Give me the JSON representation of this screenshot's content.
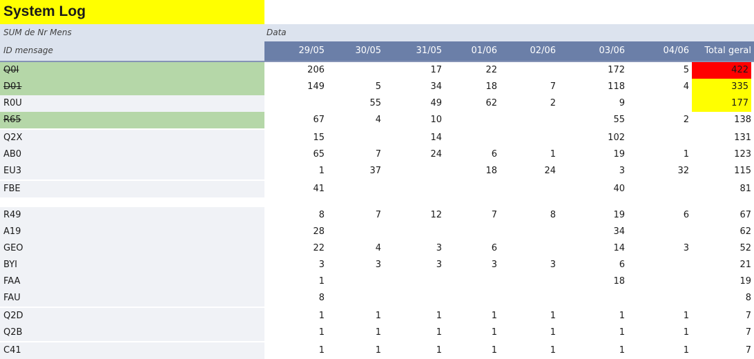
{
  "sheet": {
    "title": "System Log",
    "pivot_value_label": "SUM de Nr Mens",
    "column_field_label": "Data",
    "row_field_label": "ID mensage",
    "columns": [
      "29/05",
      "30/05",
      "31/05",
      "01/06",
      "02/06",
      "03/06",
      "04/06",
      "Total geral"
    ],
    "colors": {
      "title_fill": "#ffff00",
      "header_fill": "#6b7fa8",
      "header_light": "#dce3ee",
      "highlight_row": "#b5d7a8",
      "total_red": "#ff0000",
      "total_yellow": "#ffff00"
    },
    "rows": [
      {
        "id": "Q0I",
        "struck": true,
        "highlight": true,
        "values": [
          "206",
          "",
          "17",
          "22",
          "",
          "172",
          "5"
        ],
        "total": "422",
        "total_fill": "red"
      },
      {
        "id": "D01",
        "struck": true,
        "highlight": true,
        "values": [
          "149",
          "5",
          "34",
          "18",
          "7",
          "118",
          "4"
        ],
        "total": "335",
        "total_fill": "yellow"
      },
      {
        "id": "R0U",
        "struck": false,
        "highlight": false,
        "values": [
          "",
          "55",
          "49",
          "62",
          "2",
          "9",
          ""
        ],
        "total": "177",
        "total_fill": "yellow"
      },
      {
        "id": "R65",
        "struck": true,
        "highlight": true,
        "values": [
          "67",
          "4",
          "10",
          "",
          "",
          "55",
          "2"
        ],
        "total": "138",
        "total_fill": ""
      },
      {
        "id": "Q2X",
        "struck": false,
        "highlight": false,
        "values": [
          "15",
          "",
          "14",
          "",
          "",
          "102",
          ""
        ],
        "total": "131",
        "total_fill": ""
      },
      {
        "id": "AB0",
        "struck": false,
        "highlight": false,
        "values": [
          "65",
          "7",
          "24",
          "6",
          "1",
          "19",
          "1"
        ],
        "total": "123",
        "total_fill": ""
      },
      {
        "id": "EU3",
        "struck": false,
        "highlight": false,
        "values": [
          "1",
          "37",
          "",
          "18",
          "24",
          "3",
          "32"
        ],
        "total": "115",
        "total_fill": ""
      },
      {
        "id": "FBE",
        "struck": false,
        "highlight": false,
        "values": [
          "41",
          "",
          "",
          "",
          "",
          "40",
          ""
        ],
        "total": "81",
        "total_fill": ""
      },
      {
        "id": "R49",
        "struck": false,
        "highlight": false,
        "values": [
          "8",
          "7",
          "12",
          "7",
          "8",
          "19",
          "6"
        ],
        "total": "67",
        "total_fill": ""
      },
      {
        "id": "A19",
        "struck": false,
        "highlight": false,
        "values": [
          "28",
          "",
          "",
          "",
          "",
          "34",
          ""
        ],
        "total": "62",
        "total_fill": ""
      },
      {
        "id": "GEO",
        "struck": false,
        "highlight": false,
        "values": [
          "22",
          "4",
          "3",
          "6",
          "",
          "14",
          "3"
        ],
        "total": "52",
        "total_fill": ""
      },
      {
        "id": "BYI",
        "struck": false,
        "highlight": false,
        "values": [
          "3",
          "3",
          "3",
          "3",
          "3",
          "6",
          ""
        ],
        "total": "21",
        "total_fill": ""
      },
      {
        "id": "FAA",
        "struck": false,
        "highlight": false,
        "values": [
          "1",
          "",
          "",
          "",
          "",
          "18",
          ""
        ],
        "total": "19",
        "total_fill": ""
      },
      {
        "id": "FAU",
        "struck": false,
        "highlight": false,
        "values": [
          "8",
          "",
          "",
          "",
          "",
          "",
          ""
        ],
        "total": "8",
        "total_fill": ""
      },
      {
        "id": "Q2D",
        "struck": false,
        "highlight": false,
        "values": [
          "1",
          "1",
          "1",
          "1",
          "1",
          "1",
          "1"
        ],
        "total": "7",
        "total_fill": ""
      },
      {
        "id": "Q2B",
        "struck": false,
        "highlight": false,
        "values": [
          "1",
          "1",
          "1",
          "1",
          "1",
          "1",
          "1"
        ],
        "total": "7",
        "total_fill": ""
      },
      {
        "id": "C41",
        "struck": false,
        "highlight": false,
        "values": [
          "1",
          "1",
          "1",
          "1",
          "1",
          "1",
          "1"
        ],
        "total": "7",
        "total_fill": ""
      }
    ]
  }
}
